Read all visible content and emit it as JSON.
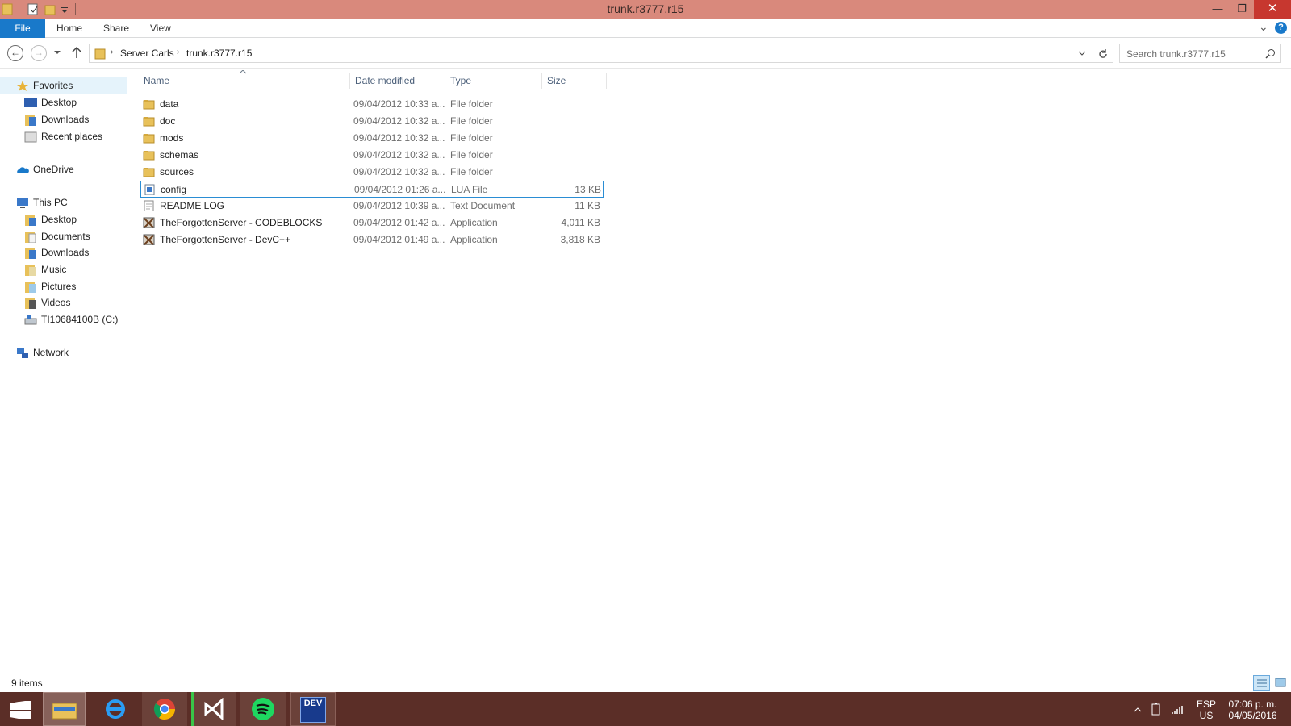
{
  "window": {
    "title": "trunk.r3777.r15",
    "controls": {
      "minimize": "—",
      "restore": "❐",
      "close": "✕"
    }
  },
  "ribbon": {
    "tabs": [
      "File",
      "Home",
      "Share",
      "View"
    ],
    "expand_glyph": "⌄",
    "help_glyph": "?"
  },
  "address": {
    "breadcrumb": [
      "Server Carls",
      "trunk.r3777.r15"
    ],
    "search_placeholder": "Search trunk.r3777.r15"
  },
  "nav": {
    "favorites": {
      "label": "Favorites",
      "items": [
        "Desktop",
        "Downloads",
        "Recent places"
      ]
    },
    "onedrive": "OneDrive",
    "thispc": {
      "label": "This PC",
      "items": [
        "Desktop",
        "Documents",
        "Downloads",
        "Music",
        "Pictures",
        "Videos",
        "TI10684100B (C:)"
      ]
    },
    "network": "Network"
  },
  "columns": {
    "name": "Name",
    "date": "Date modified",
    "type": "Type",
    "size": "Size"
  },
  "files": [
    {
      "name": "data",
      "date": "09/04/2012 10:33 a...",
      "type": "File folder",
      "size": "",
      "icon": "folder-icon"
    },
    {
      "name": "doc",
      "date": "09/04/2012 10:32 a...",
      "type": "File folder",
      "size": "",
      "icon": "folder-icon"
    },
    {
      "name": "mods",
      "date": "09/04/2012 10:32 a...",
      "type": "File folder",
      "size": "",
      "icon": "folder-icon"
    },
    {
      "name": "schemas",
      "date": "09/04/2012 10:32 a...",
      "type": "File folder",
      "size": "",
      "icon": "folder-icon"
    },
    {
      "name": "sources",
      "date": "09/04/2012 10:32 a...",
      "type": "File folder",
      "size": "",
      "icon": "folder-icon"
    },
    {
      "name": "config",
      "date": "09/04/2012 01:26 a...",
      "type": "LUA File",
      "size": "13 KB",
      "icon": "lua-file-icon",
      "selected": true
    },
    {
      "name": "README LOG",
      "date": "09/04/2012 10:39 a...",
      "type": "Text Document",
      "size": "11 KB",
      "icon": "text-file-icon"
    },
    {
      "name": "TheForgottenServer - CODEBLOCKS",
      "date": "09/04/2012 01:42 a...",
      "type": "Application",
      "size": "4,011 KB",
      "icon": "application-icon"
    },
    {
      "name": "TheForgottenServer - DevC++",
      "date": "09/04/2012 01:49 a...",
      "type": "Application",
      "size": "3,818 KB",
      "icon": "application-icon"
    }
  ],
  "status": {
    "items": "9 items"
  },
  "taskbar": {
    "apps": [
      "file-explorer",
      "internet-explorer",
      "chrome",
      "visual-studio",
      "spotify",
      "dev-cpp"
    ],
    "devcpp_label": "DEV",
    "language": [
      "ESP",
      "US"
    ],
    "time": "07:06 p. m.",
    "date": "04/05/2016"
  },
  "colors": {
    "titlebar": "#d9897c",
    "accent": "#1979ca",
    "taskbar": "#5b2e27",
    "close": "#c7372f"
  }
}
